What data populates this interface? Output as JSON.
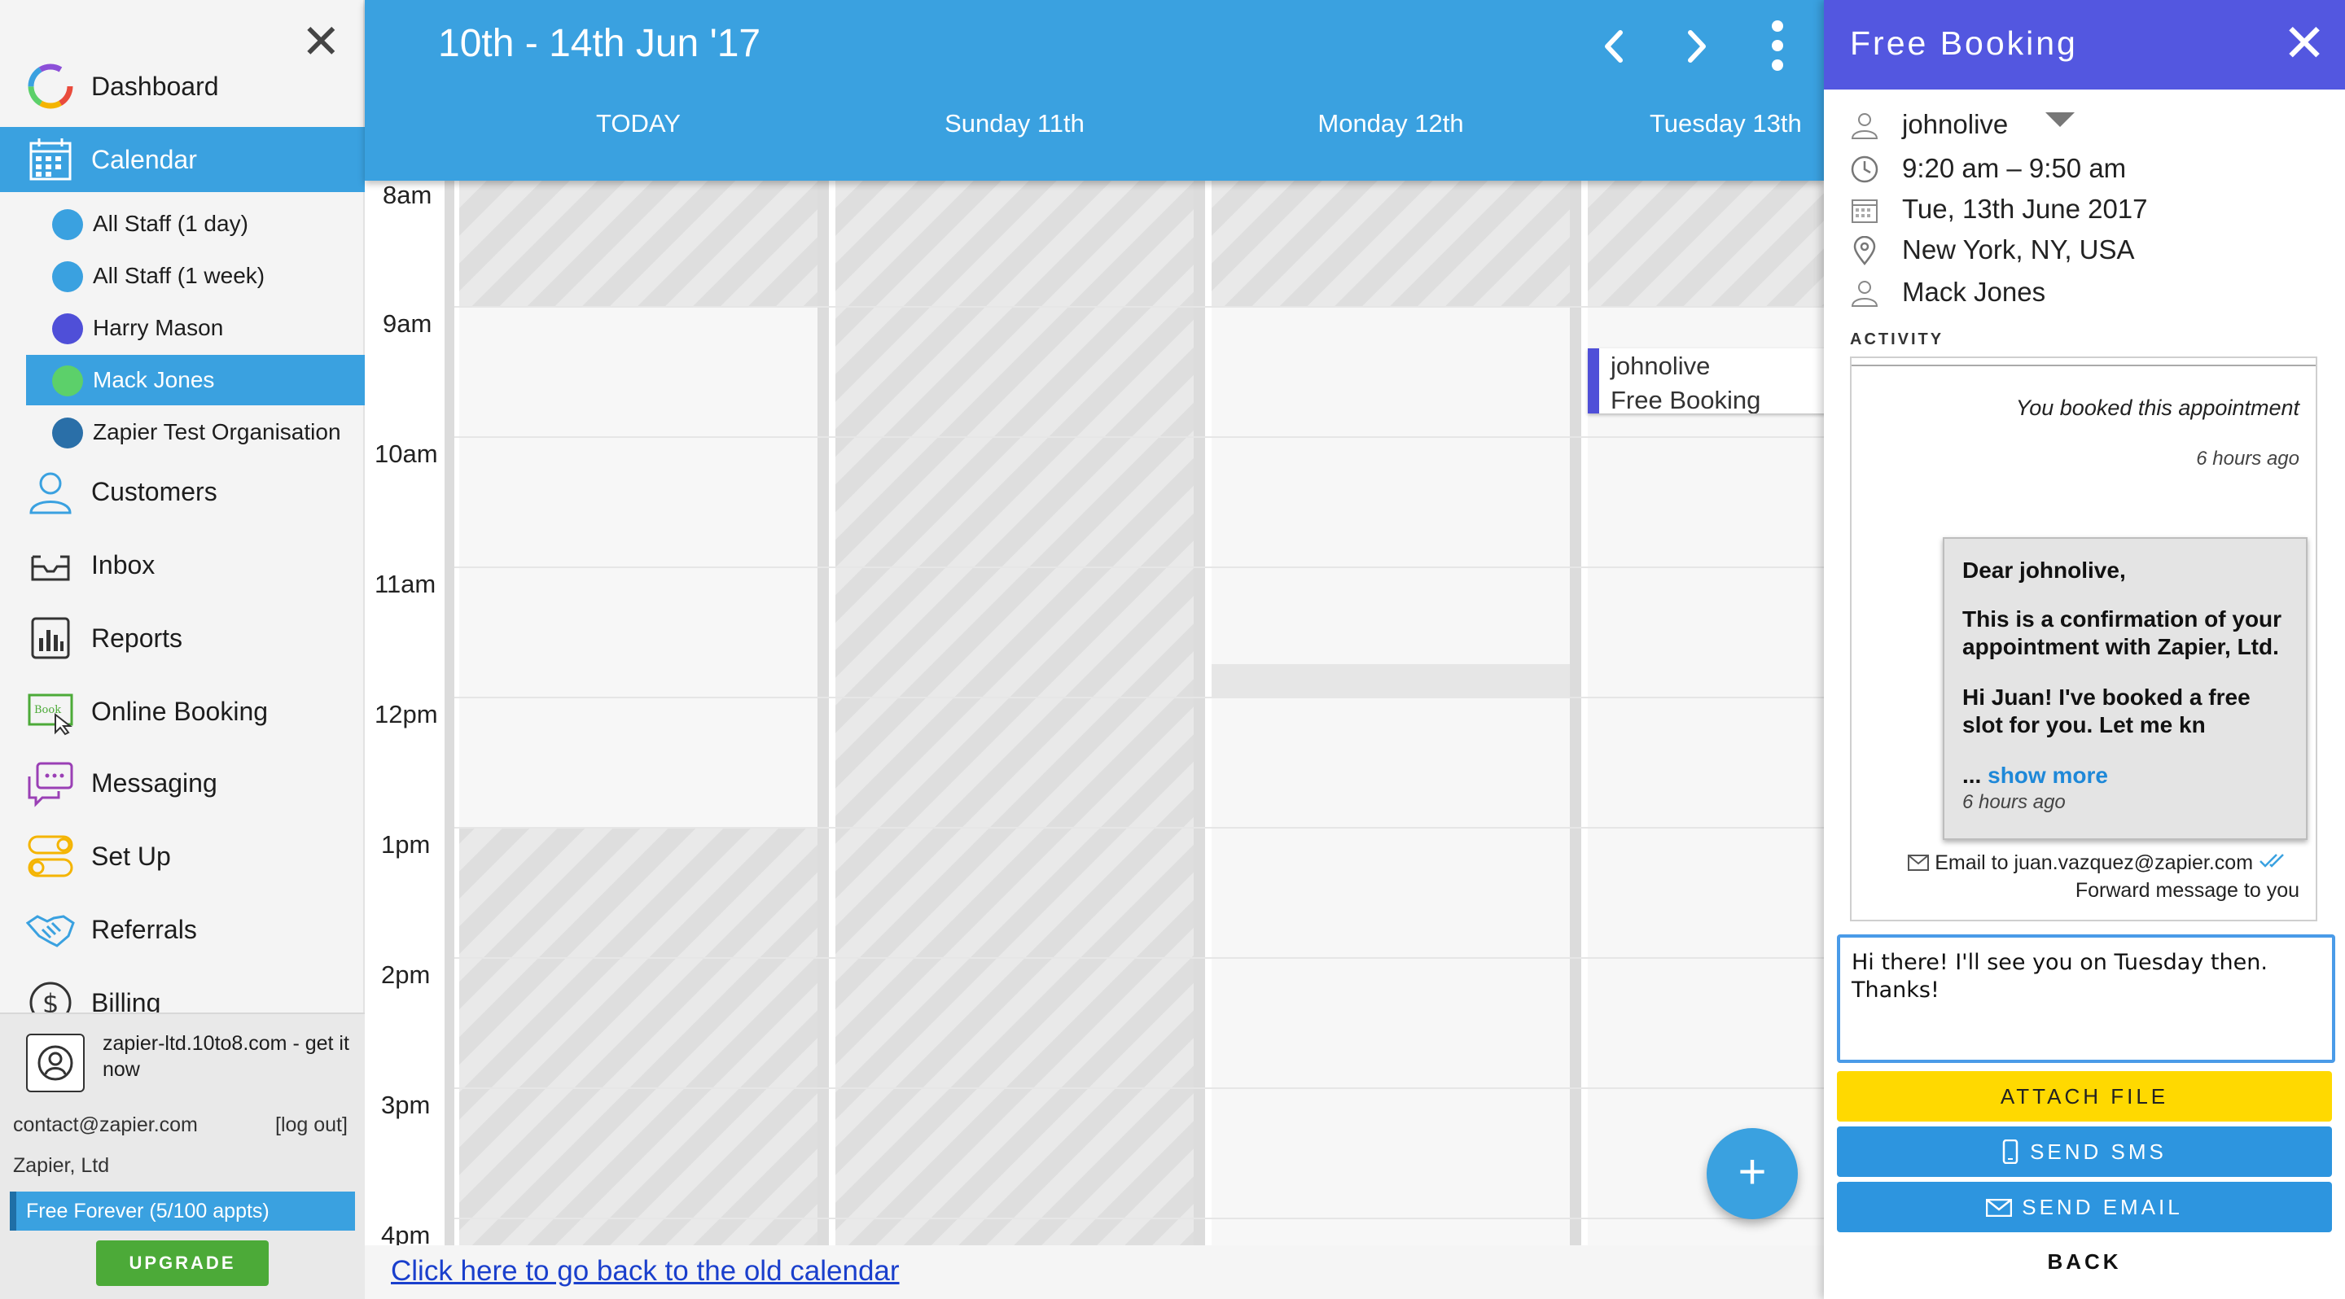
{
  "sidebar": {
    "nav": [
      {
        "label": "Dashboard",
        "icon": "dashboard-ring-icon"
      },
      {
        "label": "Calendar",
        "icon": "calendar-icon",
        "active": true
      },
      {
        "label": "Customers",
        "icon": "customers-icon"
      },
      {
        "label": "Inbox",
        "icon": "inbox-icon"
      },
      {
        "label": "Reports",
        "icon": "reports-icon"
      },
      {
        "label": "Online Booking",
        "icon": "online-booking-icon"
      },
      {
        "label": "Messaging",
        "icon": "messaging-icon"
      },
      {
        "label": "Set Up",
        "icon": "setup-toggle-icon"
      },
      {
        "label": "Referrals",
        "icon": "handshake-icon"
      },
      {
        "label": "Billing",
        "icon": "dollar-icon"
      }
    ],
    "staff": [
      {
        "label": "All Staff (1 day)",
        "color": "#3aa1e0"
      },
      {
        "label": "All Staff (1 week)",
        "color": "#3aa1e0"
      },
      {
        "label": "Harry Mason",
        "color": "#4f4fd8"
      },
      {
        "label": "Mack Jones",
        "color": "#5cd06a",
        "active": true
      },
      {
        "label": "Zapier Test Organisation",
        "color": "#2a6fa8"
      }
    ],
    "footer": {
      "account_link": "zapier-ltd.10to8.com - get it now",
      "email": "contact@zapier.com",
      "logout": "[log out]",
      "org": "Zapier, Ltd",
      "plan": "Free Forever (5/100 appts)",
      "upgrade": "UPGRADE"
    }
  },
  "calendar": {
    "range": "10th - 14th Jun '17",
    "days": [
      "TODAY",
      "Sunday 11th",
      "Monday 12th",
      "Tuesday 13th"
    ],
    "times": [
      "8am",
      "9am",
      "10am",
      "11am",
      "12pm",
      "1pm",
      "2pm",
      "3pm",
      "4pm"
    ],
    "event": {
      "line1": "johnolive",
      "line2": "Free Booking",
      "color": "#4f4fd8"
    },
    "fab": "+",
    "old_link": "Click here to go back to the old calendar"
  },
  "panel": {
    "title": "Free Booking",
    "customer": "johnolive",
    "time": "9:20 am – 9:50 am",
    "date": "Tue, 13th June 2017",
    "location": " New York, NY, USA",
    "staff": "Mack Jones",
    "activity_label": "ACTIVITY",
    "activity": {
      "booked": "You booked this appointment",
      "booked_time": "6 hours ago",
      "greeting": "Dear johnolive,",
      "para1": "This is a confirmation of your appointment with Zapier, Ltd.",
      "para2": "Hi Juan! I've booked a free slot for you. Let me kn",
      "ellipsis": "... ",
      "show_more": "show more",
      "msg_time": "6 hours ago",
      "email_to": "Email to juan.vazquez@zapier.com",
      "forward": "Forward message to you"
    },
    "reply_text": "Hi there! I'll see you on Tuesday then. Thanks!",
    "buttons": {
      "attach": "ATTACH FILE",
      "sms": "SEND SMS",
      "email": "SEND EMAIL",
      "back": "BACK"
    }
  },
  "colors": {
    "brand_blue": "#3aa1e0",
    "panel_purple": "#5357e0",
    "attach_yellow": "#ffd900",
    "upgrade_green": "#4caa38"
  }
}
